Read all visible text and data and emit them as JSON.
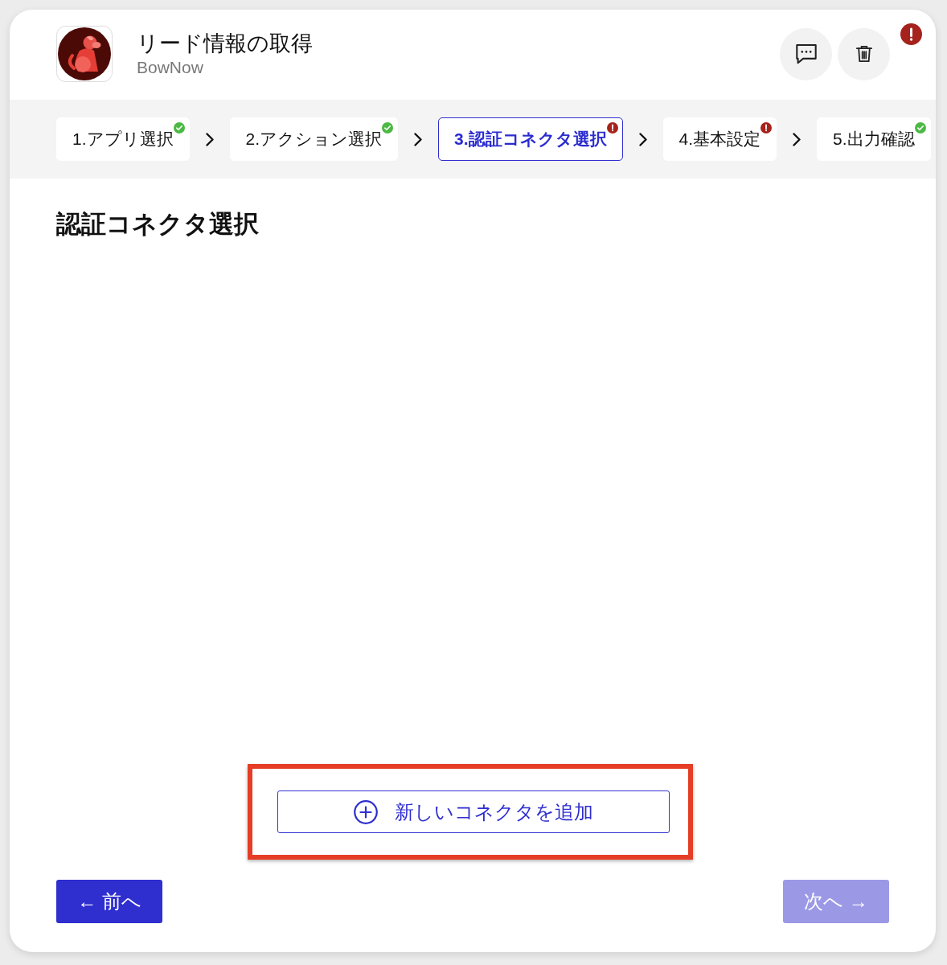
{
  "header": {
    "title": "リード情報の取得",
    "app_name": "BowNow",
    "alert": true,
    "actions": [
      {
        "kind": "comment"
      },
      {
        "kind": "delete"
      }
    ]
  },
  "steps": [
    {
      "label": "1.アプリ選択",
      "selected": false,
      "complete": true
    },
    {
      "label": "2.アクション選択",
      "selected": false,
      "complete": true
    },
    {
      "label": "3.認証コネクタ選択",
      "selected": true,
      "complete": false
    },
    {
      "label": "4.基本設定",
      "selected": false,
      "complete": false
    },
    {
      "label": "5.出力確認",
      "selected": false,
      "complete": true
    }
  ],
  "section": {
    "title": "認証コネクタ選択"
  },
  "add_connector": {
    "label": "新しいコネクタを追加",
    "highlighted": true
  },
  "footer": {
    "back": {
      "label": "← 前へ",
      "disabled": false
    },
    "next": {
      "label": "次へ →",
      "disabled": true
    }
  }
}
